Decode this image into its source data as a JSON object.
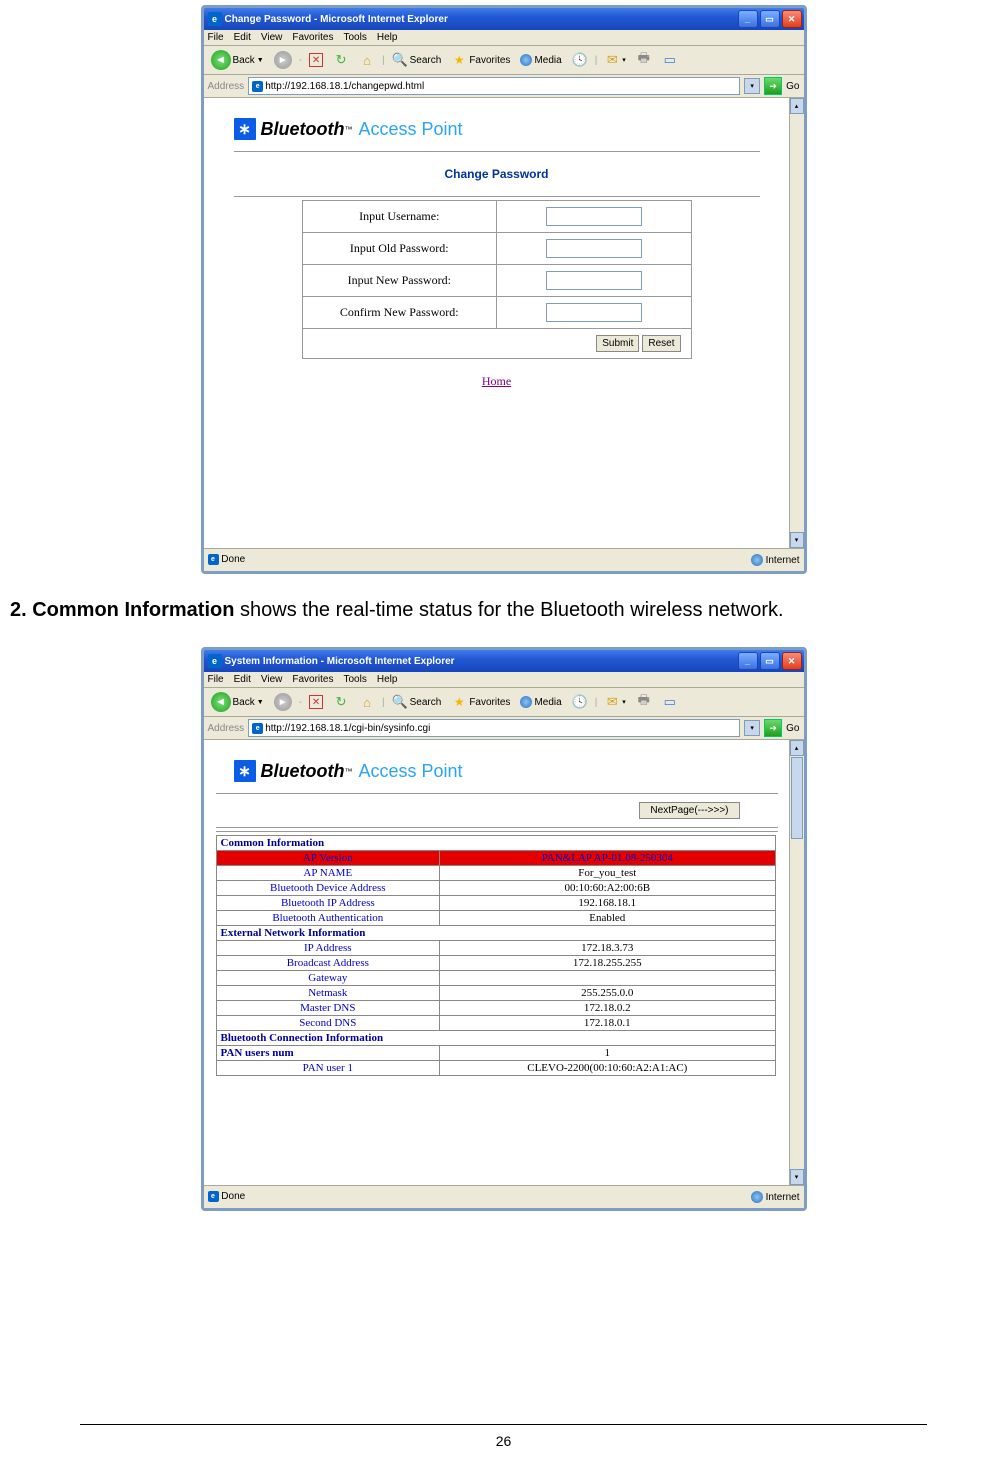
{
  "page_number": "26",
  "body_text_bold": "2. Common Information",
  "body_text_rest": " shows the real-time status for the Bluetooth wireless network.",
  "shot1": {
    "title": "Change Password - Microsoft Internet Explorer",
    "menu": [
      "File",
      "Edit",
      "View",
      "Favorites",
      "Tools",
      "Help"
    ],
    "toolbar": {
      "back": "Back",
      "search": "Search",
      "favorites": "Favorites",
      "media": "Media"
    },
    "address_label": "Address",
    "address": "http://192.168.18.1/changepwd.html",
    "go": "Go",
    "logo": {
      "bt": "Bluetooth",
      "tm": "™",
      "ap": "Access Point"
    },
    "heading": "Change Password",
    "rows": [
      {
        "label": "Input Username:"
      },
      {
        "label": "Input Old Password:"
      },
      {
        "label": "Input New Password:"
      },
      {
        "label": "Confirm New Password:"
      }
    ],
    "submit": "Submit",
    "reset": "Reset",
    "home": "Home",
    "status_left": "Done",
    "status_right": "Internet"
  },
  "shot2": {
    "title": "System Information - Microsoft Internet Explorer",
    "menu": [
      "File",
      "Edit",
      "View",
      "Favorites",
      "Tools",
      "Help"
    ],
    "toolbar": {
      "back": "Back",
      "search": "Search",
      "favorites": "Favorites",
      "media": "Media"
    },
    "address_label": "Address",
    "address": "http://192.168.18.1/cgi-bin/sysinfo.cgi",
    "go": "Go",
    "logo": {
      "bt": "Bluetooth",
      "tm": "™",
      "ap": "Access Point"
    },
    "nextpage": "NextPage(--->>>)",
    "sec1": "Common Information",
    "sec1_rows": [
      {
        "k": "AP Version",
        "v": "PAN&LAP AP-01.08-250304",
        "red": true
      },
      {
        "k": "AP NAME",
        "v": "For_you_test"
      },
      {
        "k": "Bluetooth Device Address",
        "v": "00:10:60:A2:00:6B"
      },
      {
        "k": "Bluetooth IP Address",
        "v": "192.168.18.1"
      },
      {
        "k": "Bluetooth Authentication",
        "v": "Enabled"
      }
    ],
    "sec2": "External Network Information",
    "sec2_rows": [
      {
        "k": "IP Address",
        "v": "172.18.3.73"
      },
      {
        "k": "Broadcast Address",
        "v": "172.18.255.255"
      },
      {
        "k": "Gateway",
        "v": ""
      },
      {
        "k": "Netmask",
        "v": "255.255.0.0"
      },
      {
        "k": "Master DNS",
        "v": "172.18.0.2"
      },
      {
        "k": "Second DNS",
        "v": "172.18.0.1"
      }
    ],
    "sec3": "Bluetooth Connection Information",
    "sec3_rows": [
      {
        "k": "PAN users num",
        "v": "1",
        "kbold": true
      },
      {
        "k": "PAN user 1",
        "v": "CLEVO-2200(00:10:60:A2:A1:AC)"
      }
    ],
    "status_left": "Done",
    "status_right": "Internet"
  }
}
